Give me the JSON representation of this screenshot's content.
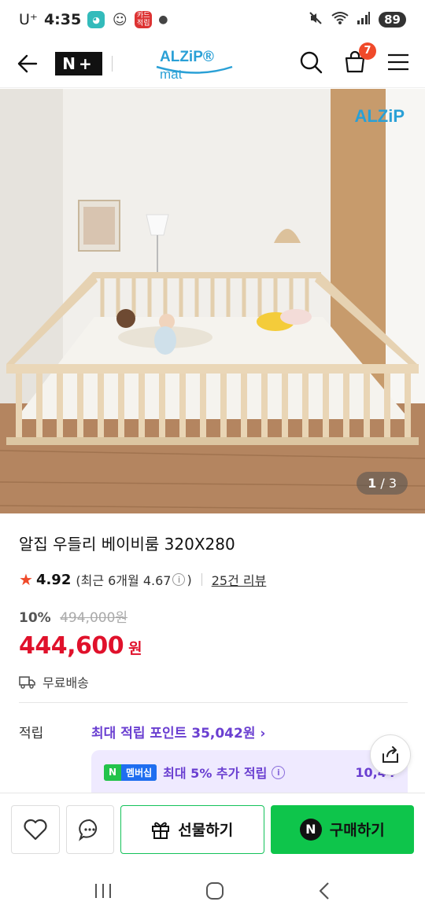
{
  "status_bar": {
    "carrier": "U⁺",
    "time": "4:35",
    "battery": "89",
    "notif_text": "카드 적립"
  },
  "header": {
    "nplus_label": "N+",
    "brand_name": "ALZiP",
    "brand_suffix": "mat",
    "cart_count": "7"
  },
  "hero": {
    "brand_logo": "ALZiP",
    "page_current": "1",
    "page_sep": " / ",
    "page_total": "3"
  },
  "product": {
    "title": "알집 우들리 베이비룸 320X280",
    "rating": "4.92",
    "rating_recent": "(최근 6개월 4.67",
    "rating_close": ")",
    "review_count": "25건 리뷰",
    "discount_rate": "10%",
    "original_price": "494,000원",
    "price": "444,600",
    "currency": "원",
    "shipping": "무료배송"
  },
  "points": {
    "label": "적립",
    "max_points": "최대 적립 포인트 35,042원",
    "chevron": "›",
    "badge_n": "N",
    "badge_text": "멤버십",
    "member_line": "최대 5% 추가 적립",
    "member_amount": "10,44"
  },
  "actions": {
    "gift_label": "선물하기",
    "buy_label": "구매하기",
    "buy_badge": "N"
  },
  "colors": {
    "price": "#e0112b",
    "points": "#6a3fd1",
    "buy_button": "#0ec54b",
    "star": "#f04a2a"
  }
}
